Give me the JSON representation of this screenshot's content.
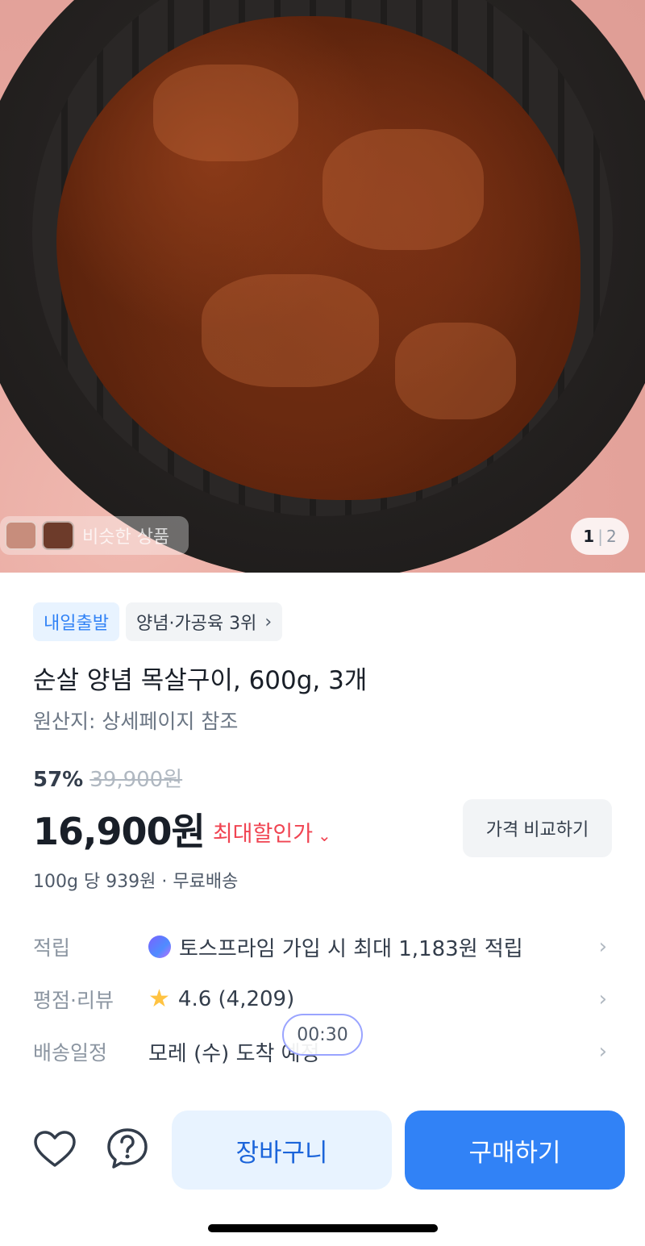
{
  "gallery": {
    "similar_label": "비슷한 상품",
    "page_current": "1",
    "page_separator": "|",
    "page_total": "2"
  },
  "chips": {
    "delivery": "내일출발",
    "ranking": "양념·가공육 3위",
    "ranking_chevron": "›"
  },
  "product": {
    "title": "순살 양념 목살구이, 600g, 3개",
    "origin": "원산지: 상세페이지 참조",
    "discount_percent": "57%",
    "original_price": "39,900원",
    "price": "16,900원",
    "max_discount_label": "최대할인가",
    "compare_button": "가격 비교하기",
    "unit_info": "100g 당 939원 · 무료배송"
  },
  "info": {
    "points_label": "적립",
    "points_value": "토스프라임 가입 시 최대 1,183원 적립",
    "rating_label": "평점·리뷰",
    "rating_value": "4.6 (4,209)",
    "delivery_label": "배송일정",
    "delivery_value": "모레 (수) 도착 예정",
    "chevron": "›"
  },
  "timer": "00:30",
  "bottom": {
    "cart_button": "장바구니",
    "buy_button": "구매하기"
  },
  "colors": {
    "accent": "#3182f6",
    "sale_red": "#f04452",
    "star": "#ffc342"
  }
}
